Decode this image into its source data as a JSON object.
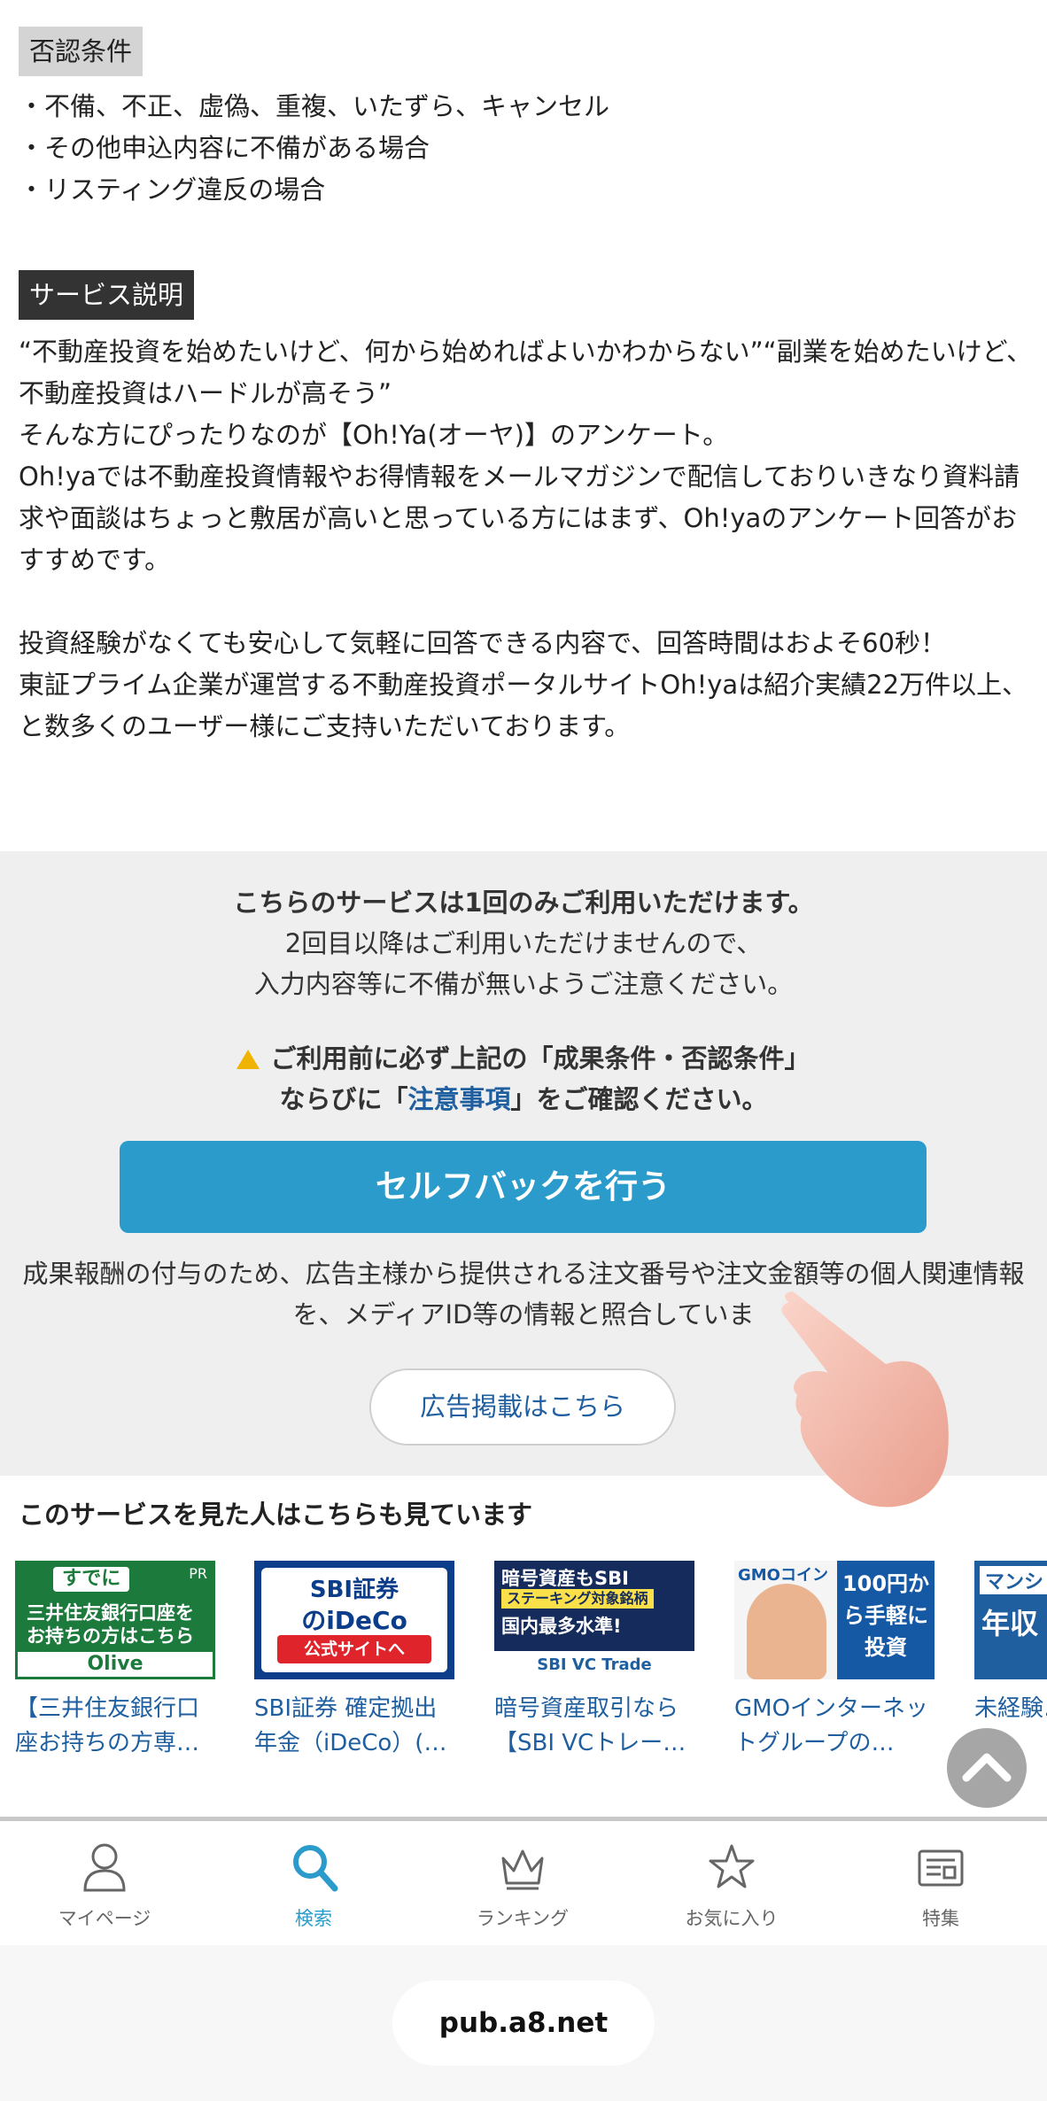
{
  "rejection": {
    "tag": "否認条件",
    "items": [
      "・不備、不正、虚偽、重複、いたずら、キャンセル",
      "・その他申込内容に不備がある場合",
      "・リスティング違反の場合"
    ]
  },
  "service": {
    "tag": "サービス説明",
    "paragraphs": [
      "“不動産投資を始めたいけど、何から始めればよいかわからない”“副業を始めたいけど、不動産投資はハードルが高そう”",
      "そんな方にぴったりなのが【Oh!Ya(オーヤ)】のアンケート。",
      "Oh!yaでは不動産投資情報やお得情報をメールマガジンで配信しておりいきなり資料請求や面談はちょっと敷居が高いと思っている方にはまず、Oh!yaのアンケート回答がおすすめです。",
      "投資経験がなくても安心して気軽に回答できる内容で、回答時間はおよそ60秒！",
      "東証プライム企業が運営する不動産投資ポータルサイトOh!yaは紹介実績22万件以上、と数多くのユーザー様にご支持いただいております。"
    ]
  },
  "notice": {
    "once": "こちらのサービスは1回のみご利用いただけます。",
    "line2": "2回目以降はご利用いただけませんので、",
    "line3": "入力内容等に不備が無いようご注意ください。",
    "warn_line1": "ご利用前に必ず上記の「成果条件・否認条件」",
    "warn_prefix": "ならびに「",
    "warn_link": "注意事項",
    "warn_suffix": "」をご確認ください。",
    "cta": "セルフバックを行う",
    "info": "成果報酬の付与のため、広告主様から提供される注文番号や注文金額等の個人関連情報を、メディアID等の情報と照合していま",
    "ad_link": "広告掲載はこちら"
  },
  "related": {
    "title": "このサービスを見た人はこちらも見ています",
    "cards": [
      {
        "title": "【三井住友銀行口座お持ちの方専…",
        "thumb": {
          "pr": "PR",
          "l1": "すでに",
          "l2": "三井住友銀行口座を",
          "l3": "お持ちの方はこちら",
          "l4": "Olive"
        }
      },
      {
        "title": "SBI証券 確定拠出年金（iDeCo）(…",
        "thumb": {
          "a": "SBI証券",
          "b": "のiDeCo",
          "c": "公式サイトへ"
        }
      },
      {
        "title": "暗号資産取引なら【SBI VCトレー…",
        "thumb": {
          "a": "暗号資産もSBI",
          "b": "ステーキング対象銘柄",
          "c": "国内最多水準!",
          "d": "SBI VC Trade"
        }
      },
      {
        "title": "GMOインターネットグループの…",
        "thumb": {
          "gmo": "GMOコイン",
          "blue": "100円から手軽に投資"
        }
      },
      {
        "title": "未経験…",
        "thumb": {
          "a": "マンシ",
          "b": "年収"
        }
      }
    ]
  },
  "nav": {
    "items": [
      {
        "label": "マイページ",
        "icon": "person-icon"
      },
      {
        "label": "検索",
        "icon": "search-icon"
      },
      {
        "label": "ランキング",
        "icon": "crown-icon"
      },
      {
        "label": "お気に入り",
        "icon": "star-icon"
      },
      {
        "label": "特集",
        "icon": "newspaper-icon"
      }
    ],
    "active_index": 1
  },
  "browser": {
    "url": "pub.a8.net"
  },
  "colors": {
    "accent": "#2a9bcb",
    "link": "#1f5fa0",
    "notice_bg": "#efefef"
  }
}
